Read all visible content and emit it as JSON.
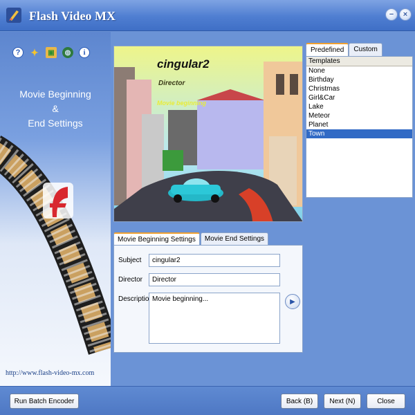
{
  "window": {
    "title": "Flash Video MX",
    "minimize_glyph": "−",
    "close_glyph": "×"
  },
  "left": {
    "tool_icons": [
      "help-icon",
      "wand-icon",
      "image-icon",
      "globe-icon",
      "info-icon"
    ],
    "heading_lines": [
      "Movie Beginning",
      "&",
      "End Settings"
    ],
    "url": "http://www.flash-video-mx.com"
  },
  "preview": {
    "title": "cingular2",
    "director": "Director",
    "begin_text": "Movie beginning"
  },
  "templates": {
    "tabs": [
      "Predefined",
      "Custom"
    ],
    "header": "Templates",
    "items": [
      "None",
      "Birthday",
      "Christmas",
      "Girl&Car",
      "Lake",
      "Meteor",
      "Planet",
      "Town"
    ],
    "selected": "Town"
  },
  "settings": {
    "tabs": [
      "Movie Beginning Settings",
      "Movie End Settings"
    ],
    "subject_label": "Subject",
    "subject_value": "cingular2",
    "director_label": "Director",
    "director_value": "Director",
    "description_label": "Description",
    "description_value": "Movie beginning..."
  },
  "buttons": {
    "run_batch": "Run Batch Encoder",
    "back": "Back (B)",
    "next": "Next (N)",
    "close": "Close"
  },
  "colors": {
    "accent": "#4f7ed1",
    "selection": "#316ac5"
  }
}
